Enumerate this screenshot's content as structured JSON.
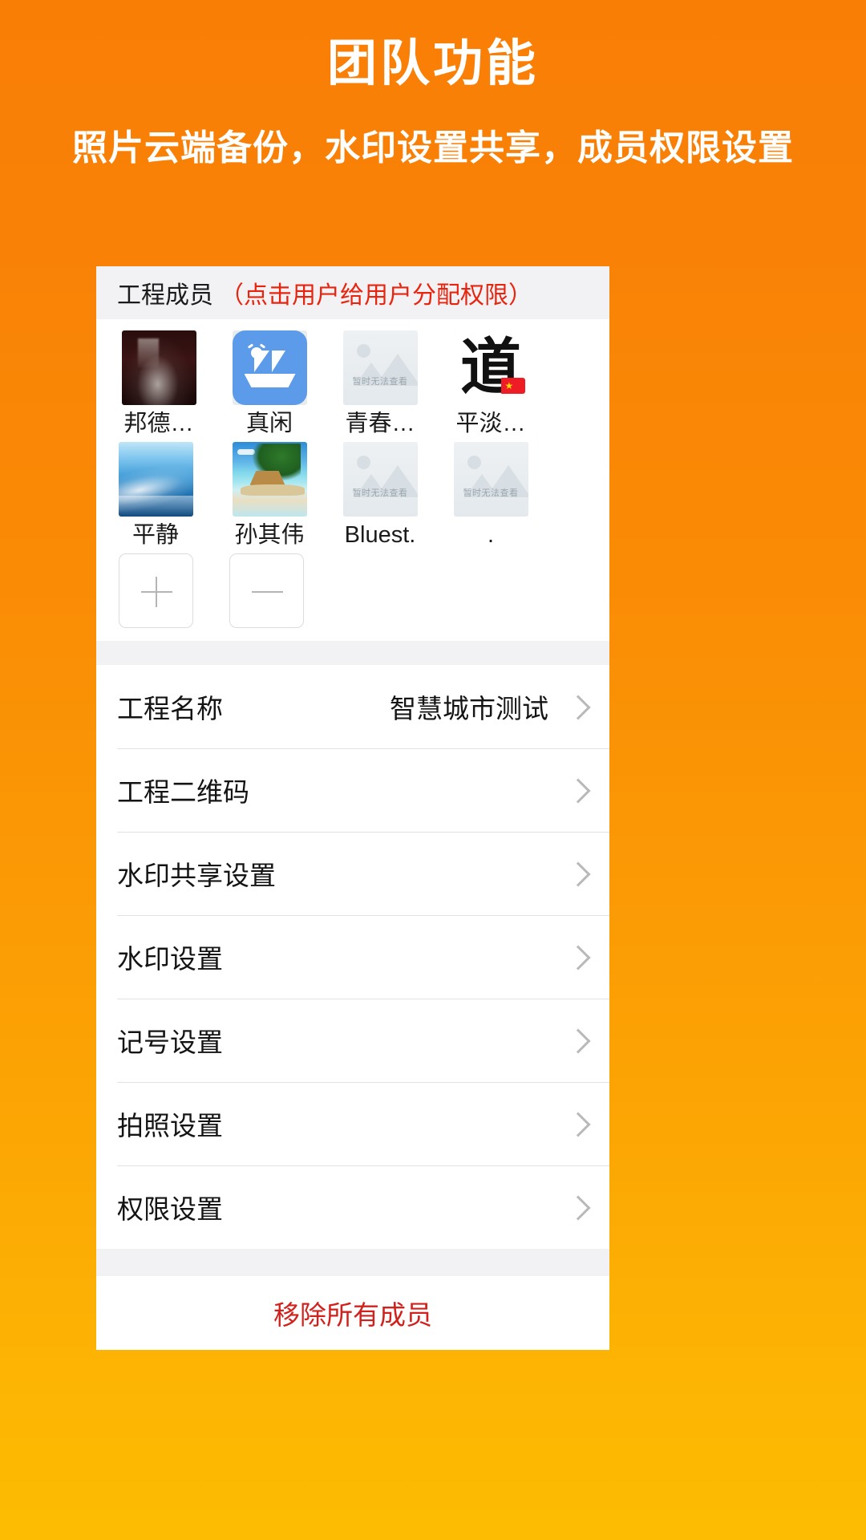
{
  "promo": {
    "title": "团队功能",
    "subtitle": "照片云端备份，水印设置共享，成员权限设置"
  },
  "colors": {
    "bg_top": "#F97E06",
    "bg_bottom": "#FDBC02",
    "accent_red": "#e8240f",
    "remove_red": "#d0211c",
    "card_bg": "#ffffff",
    "section_bg": "#f2f2f4"
  },
  "members_section": {
    "header_main": "工程成员",
    "header_note": "（点击用户给用户分配权限）",
    "placeholder_text": "暂时无法查看",
    "members": [
      {
        "name": "邦德…",
        "avatar": "book-cover-photo"
      },
      {
        "name": "真闲",
        "avatar": "sailboat-icon"
      },
      {
        "name": "青春…",
        "avatar": "image-placeholder-icon"
      },
      {
        "name": "平淡…",
        "avatar": "dao-calligraphy-photo"
      },
      {
        "name": "平静",
        "avatar": "ocean-wave-photo"
      },
      {
        "name": "孙其伟",
        "avatar": "beach-photo"
      },
      {
        "name": "Bluest.",
        "avatar": "image-placeholder-icon"
      },
      {
        "name": ".",
        "avatar": "image-placeholder-icon"
      }
    ],
    "add_button_label": "+",
    "remove_button_label": "−"
  },
  "settings_list": [
    {
      "label": "工程名称",
      "value": "智慧城市测试",
      "chevron": "chevron-right-icon"
    },
    {
      "label": "工程二维码",
      "value": "",
      "chevron": "chevron-right-icon"
    },
    {
      "label": "水印共享设置",
      "value": "",
      "chevron": "chevron-right-icon"
    },
    {
      "label": "水印设置",
      "value": "",
      "chevron": "chevron-right-icon"
    },
    {
      "label": "记号设置",
      "value": "",
      "chevron": "chevron-right-icon"
    },
    {
      "label": "拍照设置",
      "value": "",
      "chevron": "chevron-right-icon"
    },
    {
      "label": "权限设置",
      "value": "",
      "chevron": "chevron-right-icon"
    }
  ],
  "footer": {
    "remove_all_label": "移除所有成员"
  }
}
